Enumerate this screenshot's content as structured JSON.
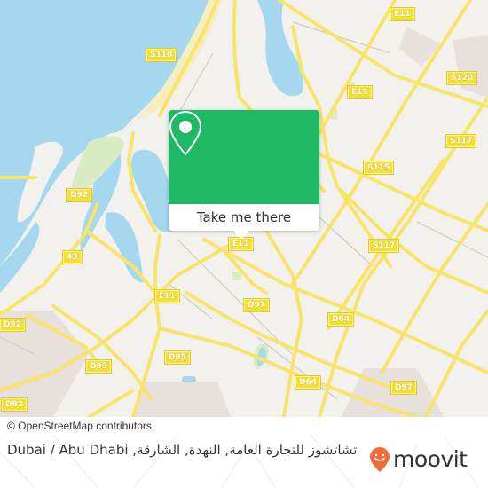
{
  "map": {
    "road_labels": [
      {
        "id": "e11-top",
        "text": "E11"
      },
      {
        "id": "s110",
        "text": "S110"
      },
      {
        "id": "s120",
        "text": "S120"
      },
      {
        "id": "e11-mid",
        "text": "E11"
      },
      {
        "id": "s117-right",
        "text": "S117"
      },
      {
        "id": "s115",
        "text": "S115"
      },
      {
        "id": "d92-top",
        "text": "D92"
      },
      {
        "id": "e11-center",
        "text": "E11"
      },
      {
        "id": "s117-center",
        "text": "S117"
      },
      {
        "id": "43",
        "text": "43"
      },
      {
        "id": "e11-left",
        "text": "E11"
      },
      {
        "id": "d97-left",
        "text": "D97"
      },
      {
        "id": "d64-upper",
        "text": "D64"
      },
      {
        "id": "d92-left",
        "text": "D92"
      },
      {
        "id": "d95",
        "text": "D95"
      },
      {
        "id": "d93",
        "text": "D93"
      },
      {
        "id": "d64-lower",
        "text": "D64"
      },
      {
        "id": "d97-right",
        "text": "D97"
      },
      {
        "id": "d82",
        "text": "D82"
      }
    ],
    "attribution": "© OpenStreetMap contributors",
    "colors": {
      "water": "#a5d8ee",
      "land": "#f2f1ee",
      "road": "#f9e46a",
      "shield": "#f2df3a",
      "park": "#d9ebc3",
      "industrial": "#e8e0dc"
    }
  },
  "popup": {
    "icon": "location-pin-icon",
    "button_label": "Take me there",
    "accent_color": "#1fb865"
  },
  "footer": {
    "place_title": "تشاتشوز للتجارة العامة, النهدة, الشارقة, Dubai / Abu Dhabi",
    "brand_name": "moovit",
    "brand_color": "#f26b3a"
  }
}
